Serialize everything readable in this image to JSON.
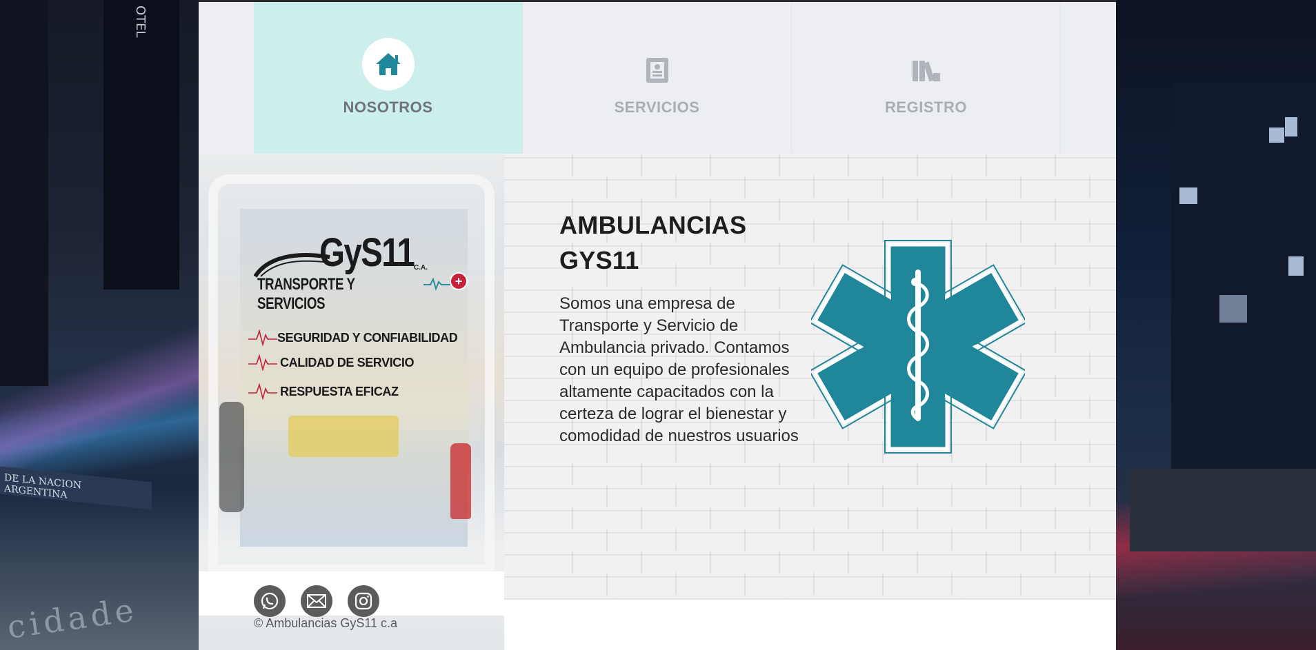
{
  "background": {
    "hotel_sign": "OTEL",
    "building_sign": "DE LA NACION ARGENTINA",
    "street_text": "cidade"
  },
  "nav": {
    "tabs": [
      {
        "label": "NOSOTROS",
        "icon": "home-icon",
        "active": true
      },
      {
        "label": "SERVICIOS",
        "icon": "document-icon",
        "active": false
      },
      {
        "label": "REGISTRO",
        "icon": "books-icon",
        "active": false
      }
    ]
  },
  "logo": {
    "main": "GyS11",
    "ca": "C.A.",
    "subtitle": "TRANSPORTE Y SERVICIOS"
  },
  "features": [
    "SEGURIDAD Y CONFIABILIDAD",
    "CALIDAD DE SERVICIO",
    "RESPUESTA EFICAZ"
  ],
  "content": {
    "heading_line1": "AMBULANCIAS",
    "heading_line2": "GYS11",
    "description": "Somos una empresa de Transporte y Servicio de Ambulancia privado. Contamos con un equipo de profesionales altamente capacitados con la certeza de lograr el bienestar y comodidad de nuestros usuarios"
  },
  "social": [
    {
      "name": "whatsapp-icon"
    },
    {
      "name": "email-icon"
    },
    {
      "name": "instagram-icon"
    }
  ],
  "footer": {
    "copyright": "© Ambulancias GyS11 c.a"
  },
  "colors": {
    "accent_teal": "#1f8799",
    "active_tab_bg": "#cdefeb",
    "nav_bg": "#eceef2",
    "logo_red": "#c8203a"
  }
}
